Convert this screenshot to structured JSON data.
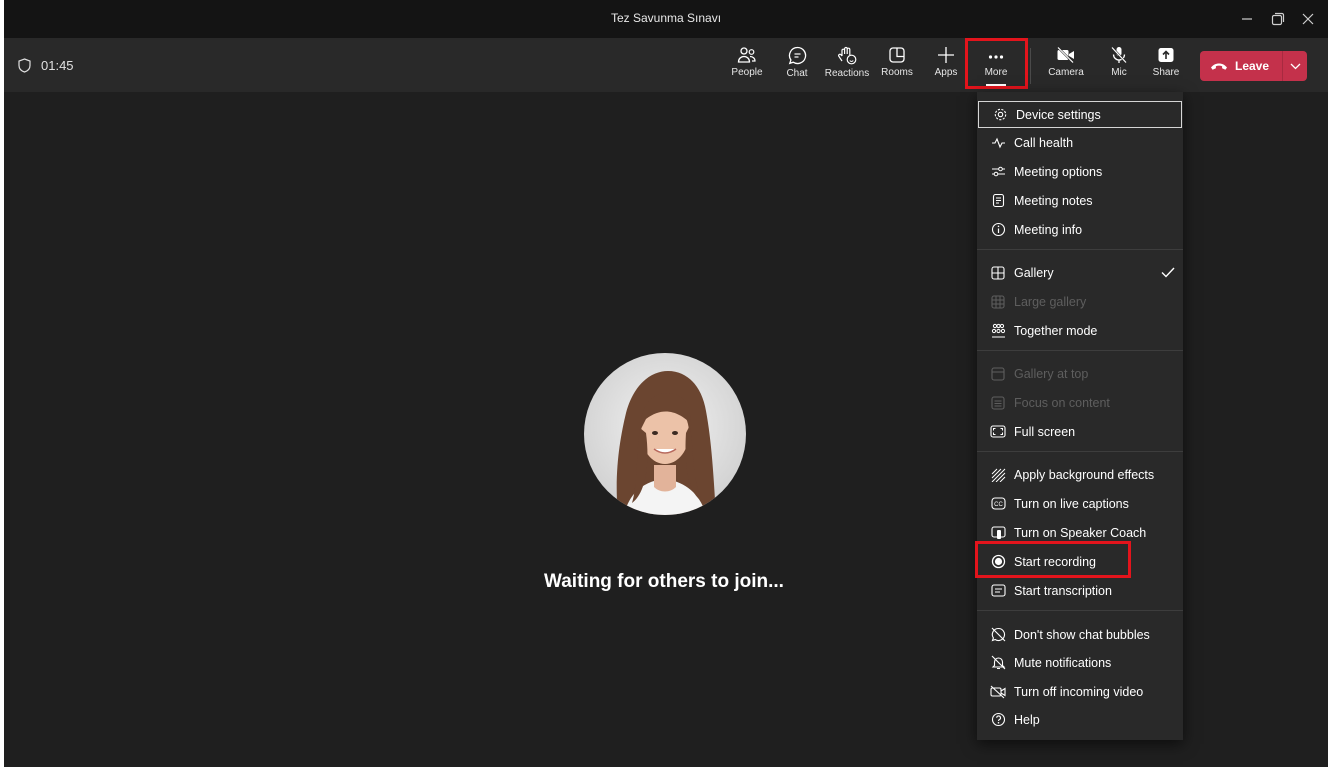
{
  "window": {
    "title": "Tez Savunma Sınavı"
  },
  "toolbar": {
    "timer": "01:45",
    "buttons": [
      {
        "label": "People",
        "icon": "people-icon"
      },
      {
        "label": "Chat",
        "icon": "chat-icon"
      },
      {
        "label": "Reactions",
        "icon": "reactions-icon"
      },
      {
        "label": "Rooms",
        "icon": "rooms-icon"
      },
      {
        "label": "Apps",
        "icon": "plus-icon"
      },
      {
        "label": "More",
        "icon": "ellipsis-icon"
      },
      {
        "label": "Camera",
        "icon": "camera-off-icon"
      },
      {
        "label": "Mic",
        "icon": "mic-off-icon"
      },
      {
        "label": "Share",
        "icon": "share-icon"
      }
    ],
    "leave_label": "Leave"
  },
  "stage": {
    "waiting_text": "Waiting for others to join..."
  },
  "more_menu": {
    "items": [
      {
        "label": "Device settings",
        "icon": "gear-icon"
      },
      {
        "label": "Call health",
        "icon": "pulse-icon"
      },
      {
        "label": "Meeting options",
        "icon": "sliders-icon"
      },
      {
        "label": "Meeting notes",
        "icon": "notes-icon"
      },
      {
        "label": "Meeting info",
        "icon": "info-icon"
      },
      {
        "label": "Gallery",
        "icon": "grid-icon",
        "checked": true
      },
      {
        "label": "Large gallery",
        "icon": "large-grid-icon",
        "disabled": true
      },
      {
        "label": "Together mode",
        "icon": "together-icon"
      },
      {
        "label": "Gallery at top",
        "icon": "gallery-top-icon",
        "disabled": true
      },
      {
        "label": "Focus on content",
        "icon": "focus-icon",
        "disabled": true
      },
      {
        "label": "Full screen",
        "icon": "fullscreen-icon"
      },
      {
        "label": "Apply background effects",
        "icon": "background-effects-icon"
      },
      {
        "label": "Turn on live captions",
        "icon": "captions-icon"
      },
      {
        "label": "Turn on Speaker Coach",
        "icon": "speaker-coach-icon"
      },
      {
        "label": "Start recording",
        "icon": "record-icon"
      },
      {
        "label": "Start transcription",
        "icon": "transcription-icon"
      },
      {
        "label": "Don't show chat bubbles",
        "icon": "chat-bubbles-off-icon"
      },
      {
        "label": "Mute notifications",
        "icon": "bell-off-icon"
      },
      {
        "label": "Turn off incoming video",
        "icon": "video-off-icon"
      },
      {
        "label": "Help",
        "icon": "help-icon"
      }
    ]
  },
  "colors": {
    "leave_button": "#c4314b",
    "highlight_box": "#e3141c",
    "stage_background": "#1f1f1f",
    "toolbar_background": "#292929"
  }
}
